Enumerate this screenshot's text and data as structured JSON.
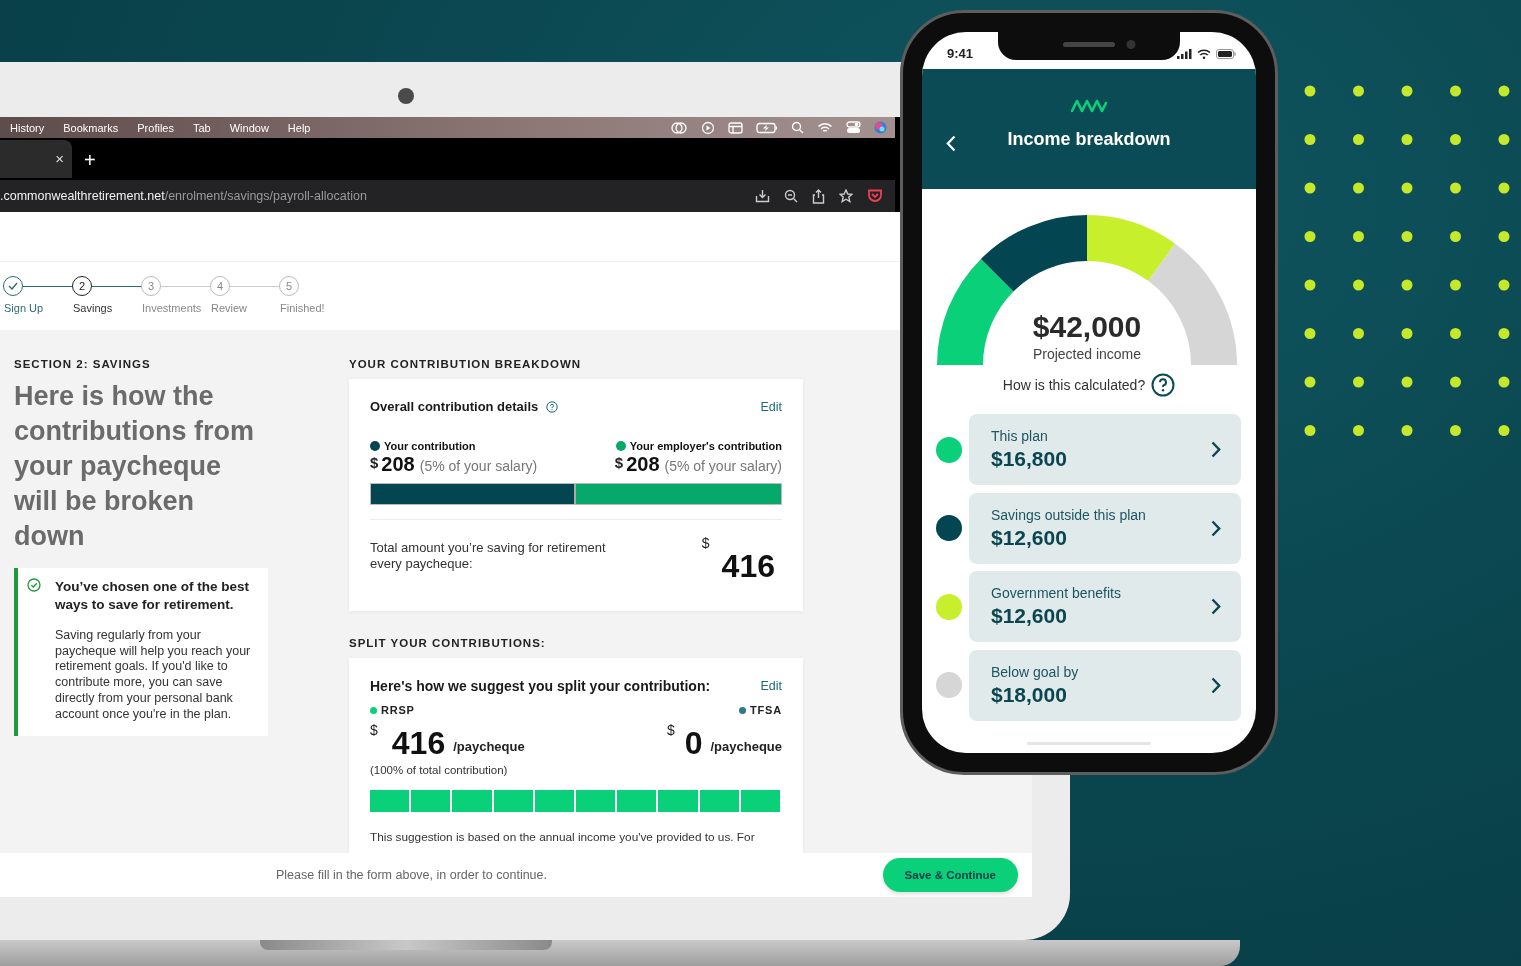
{
  "laptop": {
    "menu_bar": {
      "items": [
        "History",
        "Bookmarks",
        "Profiles",
        "Tab",
        "Window",
        "Help"
      ]
    },
    "tab_bar": {
      "close": "×",
      "new_tab": "+"
    },
    "address_bar": {
      "domain": ".commonwealthretirement.net",
      "path": "/enrolment/savings/payroll-allocation"
    },
    "page": {
      "steps": [
        {
          "label": "Sign Up",
          "completed": true,
          "selected": false
        },
        {
          "number": "2",
          "label": "Savings",
          "completed": false,
          "selected": true
        },
        {
          "number": "3",
          "label": "Investments",
          "completed": false,
          "selected": false
        },
        {
          "number": "4",
          "label": "Review",
          "completed": false,
          "selected": false
        },
        {
          "number": "5",
          "label": "Finished!",
          "completed": false,
          "selected": false
        }
      ],
      "section_label": "SECTION 2: SAVINGS",
      "heading": "Here is how the contributions from your paycheque will be broken down",
      "callout": {
        "title": "You’ve chosen one of the best ways to save for retirement.",
        "body": "Saving regularly from your paycheque will help you reach your retirement goals. If you'd like to contribute more, you can save directly from your personal bank account once you're in the plan."
      },
      "breakdown": {
        "heading": "YOUR CONTRIBUTION BREAKDOWN",
        "title": "Overall contribution details",
        "edit": "Edit",
        "parts": [
          {
            "label": "Your contribution",
            "currency": "$",
            "amount": "208",
            "note": "(5% of your salary)",
            "color": "#044552"
          },
          {
            "label": "Your employer's contribution",
            "currency": "$",
            "amount": "208",
            "note": "(5% of your salary)",
            "color": "#06a96a"
          }
        ],
        "bar": {
          "level": 0.5
        },
        "total_label": "Total amount you’re saving for retirement every paycheque:",
        "total_currency": "$",
        "total_amount": "416"
      },
      "split": {
        "heading": "SPLIT YOUR CONTRIBUTIONS:",
        "title": "Here's how we suggest you split your contribution:",
        "edit": "Edit",
        "accounts": [
          {
            "label": "RRSP",
            "currency": "$",
            "amount": "416",
            "unit": "/paycheque",
            "color": "#0bd07a"
          },
          {
            "label": "TFSA",
            "currency": "$",
            "amount": "0",
            "unit": "/paycheque",
            "color": "#2d7a86"
          }
        ],
        "share": "(100% of total contribution)",
        "bar": {
          "level": 1.0
        },
        "note": "This suggestion is based on the annual income you've provided to us. For"
      },
      "footer": {
        "message": "Please fill in the form above, in order to continue.",
        "button": "Save & Continue"
      }
    }
  },
  "phone": {
    "time": "9:41",
    "title": "Income breakdown",
    "gauge": {
      "amount": "$42,000",
      "caption": "Projected income",
      "help": "How is this calculated?"
    },
    "items": [
      {
        "name": "This plan",
        "amount": "$16,800",
        "color": "#0bd07a"
      },
      {
        "name": "Savings outside this plan",
        "amount": "$12,600",
        "color": "#044552"
      },
      {
        "name": "Government benefits",
        "amount": "$12,600",
        "color": "#c8ef2c"
      },
      {
        "name": "Below goal by",
        "amount": "$18,000",
        "color": "#d6d6d6"
      }
    ]
  }
}
